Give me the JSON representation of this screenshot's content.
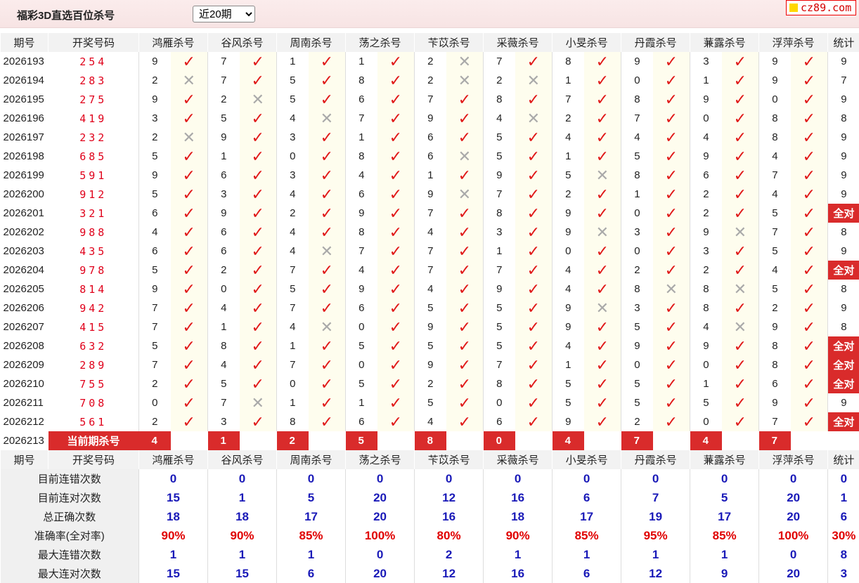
{
  "header": {
    "title": "福彩3D直选百位杀号",
    "period_select": "近20期",
    "logo": "cz89.com"
  },
  "columns": {
    "period": "期号",
    "draw": "开奖号码",
    "experts": [
      "鸿雁杀号",
      "谷风杀号",
      "周南杀号",
      "荡之杀号",
      "苄苡杀号",
      "采薇杀号",
      "小旻杀号",
      "丹霞杀号",
      "蒹露杀号",
      "浮萍杀号"
    ],
    "tally": "统计"
  },
  "rows": [
    {
      "period": "2026193",
      "draw": "254",
      "kills": [
        9,
        7,
        1,
        1,
        2,
        7,
        8,
        9,
        3,
        9
      ],
      "ok": [
        1,
        1,
        1,
        1,
        0,
        1,
        1,
        1,
        1,
        1
      ],
      "tally": "9"
    },
    {
      "period": "2026194",
      "draw": "283",
      "kills": [
        2,
        7,
        5,
        8,
        2,
        2,
        1,
        0,
        1,
        9
      ],
      "ok": [
        0,
        1,
        1,
        1,
        0,
        0,
        1,
        1,
        1,
        1
      ],
      "tally": "7"
    },
    {
      "period": "2026195",
      "draw": "275",
      "kills": [
        9,
        2,
        5,
        6,
        7,
        8,
        7,
        8,
        9,
        0
      ],
      "ok": [
        1,
        0,
        1,
        1,
        1,
        1,
        1,
        1,
        1,
        1
      ],
      "tally": "9"
    },
    {
      "period": "2026196",
      "draw": "419",
      "kills": [
        3,
        5,
        4,
        7,
        9,
        4,
        2,
        7,
        0,
        8
      ],
      "ok": [
        1,
        1,
        0,
        1,
        1,
        0,
        1,
        1,
        1,
        1
      ],
      "tally": "8"
    },
    {
      "period": "2026197",
      "draw": "232",
      "kills": [
        2,
        9,
        3,
        1,
        6,
        5,
        4,
        4,
        4,
        8
      ],
      "ok": [
        0,
        1,
        1,
        1,
        1,
        1,
        1,
        1,
        1,
        1
      ],
      "tally": "9"
    },
    {
      "period": "2026198",
      "draw": "685",
      "kills": [
        5,
        1,
        0,
        8,
        6,
        5,
        1,
        5,
        9,
        4
      ],
      "ok": [
        1,
        1,
        1,
        1,
        0,
        1,
        1,
        1,
        1,
        1
      ],
      "tally": "9"
    },
    {
      "period": "2026199",
      "draw": "591",
      "kills": [
        9,
        6,
        3,
        4,
        1,
        9,
        5,
        8,
        6,
        7
      ],
      "ok": [
        1,
        1,
        1,
        1,
        1,
        1,
        0,
        1,
        1,
        1
      ],
      "tally": "9"
    },
    {
      "period": "2026200",
      "draw": "912",
      "kills": [
        5,
        3,
        4,
        6,
        9,
        7,
        2,
        1,
        2,
        4
      ],
      "ok": [
        1,
        1,
        1,
        1,
        0,
        1,
        1,
        1,
        1,
        1
      ],
      "tally": "9"
    },
    {
      "period": "2026201",
      "draw": "321",
      "kills": [
        6,
        9,
        2,
        9,
        7,
        8,
        9,
        0,
        2,
        5
      ],
      "ok": [
        1,
        1,
        1,
        1,
        1,
        1,
        1,
        1,
        1,
        1
      ],
      "tally": "全对"
    },
    {
      "period": "2026202",
      "draw": "988",
      "kills": [
        4,
        6,
        4,
        8,
        4,
        3,
        9,
        3,
        9,
        7
      ],
      "ok": [
        1,
        1,
        1,
        1,
        1,
        1,
        0,
        1,
        0,
        1
      ],
      "tally": "8"
    },
    {
      "period": "2026203",
      "draw": "435",
      "kills": [
        6,
        6,
        4,
        7,
        7,
        1,
        0,
        0,
        3,
        5
      ],
      "ok": [
        1,
        1,
        0,
        1,
        1,
        1,
        1,
        1,
        1,
        1
      ],
      "tally": "9"
    },
    {
      "period": "2026204",
      "draw": "978",
      "kills": [
        5,
        2,
        7,
        4,
        7,
        7,
        4,
        2,
        2,
        4
      ],
      "ok": [
        1,
        1,
        1,
        1,
        1,
        1,
        1,
        1,
        1,
        1
      ],
      "tally": "全对"
    },
    {
      "period": "2026205",
      "draw": "814",
      "kills": [
        9,
        0,
        5,
        9,
        4,
        9,
        4,
        8,
        8,
        5
      ],
      "ok": [
        1,
        1,
        1,
        1,
        1,
        1,
        1,
        0,
        0,
        1
      ],
      "tally": "8"
    },
    {
      "period": "2026206",
      "draw": "942",
      "kills": [
        7,
        4,
        7,
        6,
        5,
        5,
        9,
        3,
        8,
        2
      ],
      "ok": [
        1,
        1,
        1,
        1,
        1,
        1,
        0,
        1,
        1,
        1
      ],
      "tally": "9"
    },
    {
      "period": "2026207",
      "draw": "415",
      "kills": [
        7,
        1,
        4,
        0,
        9,
        5,
        9,
        5,
        4,
        9
      ],
      "ok": [
        1,
        1,
        0,
        1,
        1,
        1,
        1,
        1,
        0,
        1
      ],
      "tally": "8"
    },
    {
      "period": "2026208",
      "draw": "632",
      "kills": [
        5,
        8,
        1,
        5,
        5,
        5,
        4,
        9,
        9,
        8
      ],
      "ok": [
        1,
        1,
        1,
        1,
        1,
        1,
        1,
        1,
        1,
        1
      ],
      "tally": "全对"
    },
    {
      "period": "2026209",
      "draw": "289",
      "kills": [
        7,
        4,
        7,
        0,
        9,
        7,
        1,
        0,
        0,
        8
      ],
      "ok": [
        1,
        1,
        1,
        1,
        1,
        1,
        1,
        1,
        1,
        1
      ],
      "tally": "全对"
    },
    {
      "period": "2026210",
      "draw": "755",
      "kills": [
        2,
        5,
        0,
        5,
        2,
        8,
        5,
        5,
        1,
        6
      ],
      "ok": [
        1,
        1,
        1,
        1,
        1,
        1,
        1,
        1,
        1,
        1
      ],
      "tally": "全对"
    },
    {
      "period": "2026211",
      "draw": "708",
      "kills": [
        0,
        7,
        1,
        1,
        5,
        0,
        5,
        5,
        5,
        9
      ],
      "ok": [
        1,
        0,
        1,
        1,
        1,
        1,
        1,
        1,
        1,
        1
      ],
      "tally": "9"
    },
    {
      "period": "2026212",
      "draw": "561",
      "kills": [
        2,
        3,
        8,
        6,
        4,
        6,
        9,
        2,
        0,
        7
      ],
      "ok": [
        1,
        1,
        1,
        1,
        1,
        1,
        1,
        1,
        1,
        1
      ],
      "tally": "全对"
    }
  ],
  "current": {
    "period": "2026213",
    "label": "当前期杀号",
    "kills": [
      4,
      1,
      2,
      5,
      8,
      0,
      4,
      7,
      4,
      7
    ]
  },
  "summary": [
    {
      "label": "目前连错次数",
      "values": [
        "0",
        "0",
        "0",
        "0",
        "0",
        "0",
        "0",
        "0",
        "0",
        "0"
      ],
      "tally": "0",
      "rate": false
    },
    {
      "label": "目前连对次数",
      "values": [
        "15",
        "1",
        "5",
        "20",
        "12",
        "16",
        "6",
        "7",
        "5",
        "20"
      ],
      "tally": "1",
      "rate": false
    },
    {
      "label": "总正确次数",
      "values": [
        "18",
        "18",
        "17",
        "20",
        "16",
        "18",
        "17",
        "19",
        "17",
        "20"
      ],
      "tally": "6",
      "rate": false
    },
    {
      "label": "准确率(全对率)",
      "values": [
        "90%",
        "90%",
        "85%",
        "100%",
        "80%",
        "90%",
        "85%",
        "95%",
        "85%",
        "100%"
      ],
      "tally": "30%",
      "rate": true
    },
    {
      "label": "最大连错次数",
      "values": [
        "1",
        "1",
        "1",
        "0",
        "2",
        "1",
        "1",
        "1",
        "1",
        "0"
      ],
      "tally": "8",
      "rate": false
    },
    {
      "label": "最大连对次数",
      "values": [
        "15",
        "15",
        "6",
        "20",
        "12",
        "16",
        "6",
        "12",
        "9",
        "20"
      ],
      "tally": "3",
      "rate": false
    }
  ],
  "icons": {
    "ok": "check-icon",
    "ng": "cross-icon"
  },
  "colors": {
    "draw": "#e0001a",
    "check": "#e01818",
    "cross": "#a9a9a9",
    "allok_bg": "#d92b2b",
    "summary_value": "#1a1ab8",
    "summary_rate": "#e00000"
  }
}
